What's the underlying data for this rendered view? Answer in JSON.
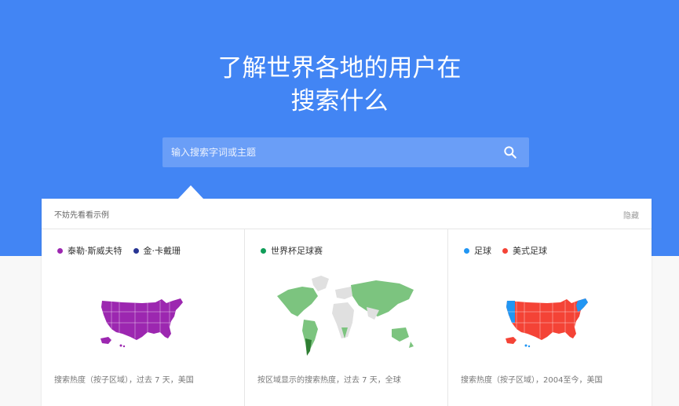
{
  "hero": {
    "title_line1": "了解世界各地的用户在",
    "title_line2": "搜索什么",
    "background_color": "#4285f4"
  },
  "search": {
    "placeholder": "输入搜索字词或主题",
    "icon": "search-icon"
  },
  "examples": {
    "title": "不妨先看看示例",
    "hide_label": "隐藏",
    "cards": [
      {
        "legend": [
          {
            "label": "泰勒·斯威夫特",
            "color": "#9c27b0"
          },
          {
            "label": "金·卡戴珊",
            "color": "#283593"
          }
        ],
        "map": "us-map",
        "footer": "搜索热度（按子区域），过去 7 天，美国"
      },
      {
        "legend": [
          {
            "label": "世界杯足球赛",
            "color": "#0f9d58"
          }
        ],
        "map": "world-map",
        "footer": "按区域显示的搜索热度，过去 7 天，全球"
      },
      {
        "legend": [
          {
            "label": "足球",
            "color": "#2196f3"
          },
          {
            "label": "美式足球",
            "color": "#f44336"
          }
        ],
        "map": "us-map",
        "footer": "搜索热度（按子区域），2004至今，美国"
      }
    ]
  }
}
